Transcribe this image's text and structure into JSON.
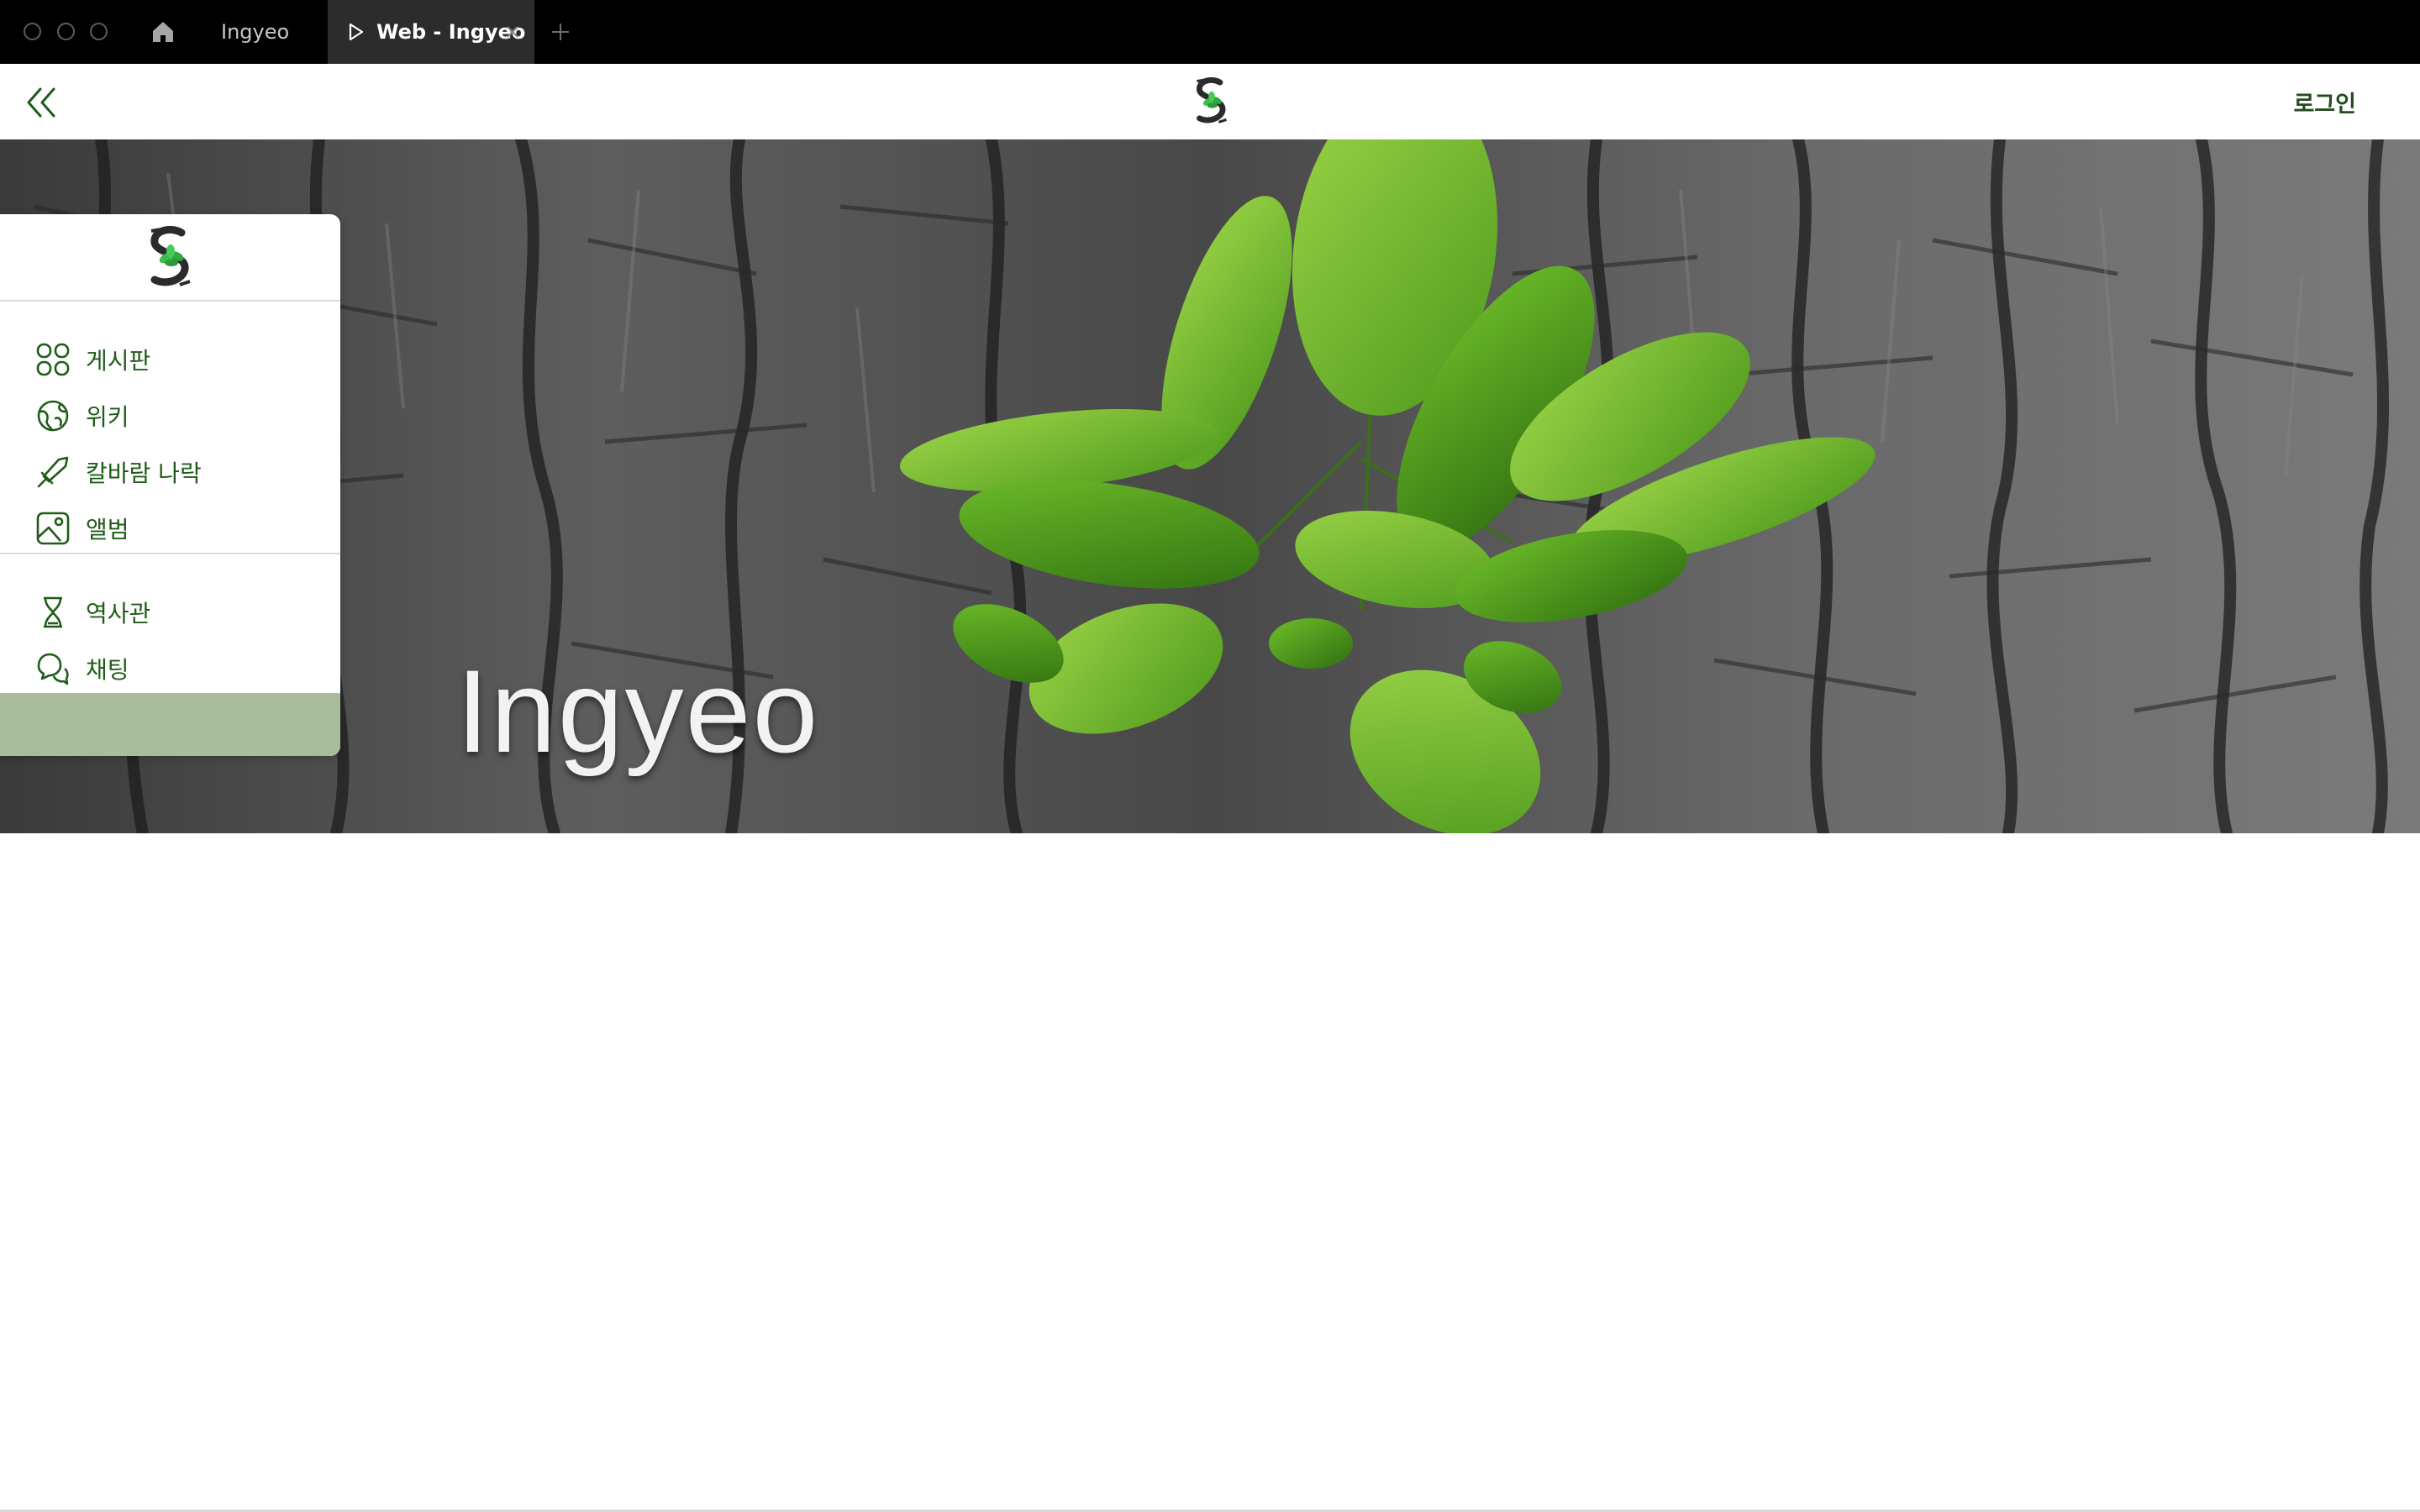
{
  "browser": {
    "tabs": [
      {
        "label": "Ingyeo",
        "active": false
      },
      {
        "label": "Web - Ingyeo",
        "active": true
      }
    ],
    "icons": {
      "home": "home-icon",
      "play": "play-icon",
      "close": "close-icon",
      "new_tab": "plus-icon"
    }
  },
  "header": {
    "collapse_icon": "double-chevron-left-icon",
    "logo_icon": "ingyeo-logo-icon",
    "login_label": "로그인"
  },
  "hero": {
    "title": "Ingyeo"
  },
  "sidebar": {
    "logo_icon": "ingyeo-logo-icon",
    "primary_items": [
      {
        "label": "게시판",
        "icon": "grid-icon"
      },
      {
        "label": "위키",
        "icon": "globe-icon"
      },
      {
        "label": "칼바람 나락",
        "icon": "sword-icon"
      },
      {
        "label": "앨범",
        "icon": "image-icon"
      }
    ],
    "secondary_items": [
      {
        "label": "역사관",
        "icon": "hourglass-icon"
      },
      {
        "label": "채팅",
        "icon": "chat-icon"
      }
    ]
  },
  "colors": {
    "accent_green": "#1f5c18",
    "login_green": "#234d1e",
    "panel_footer": "#a9bd9d",
    "tabbar_bg": "#000000",
    "active_tab_bg": "#2c2c2c"
  }
}
